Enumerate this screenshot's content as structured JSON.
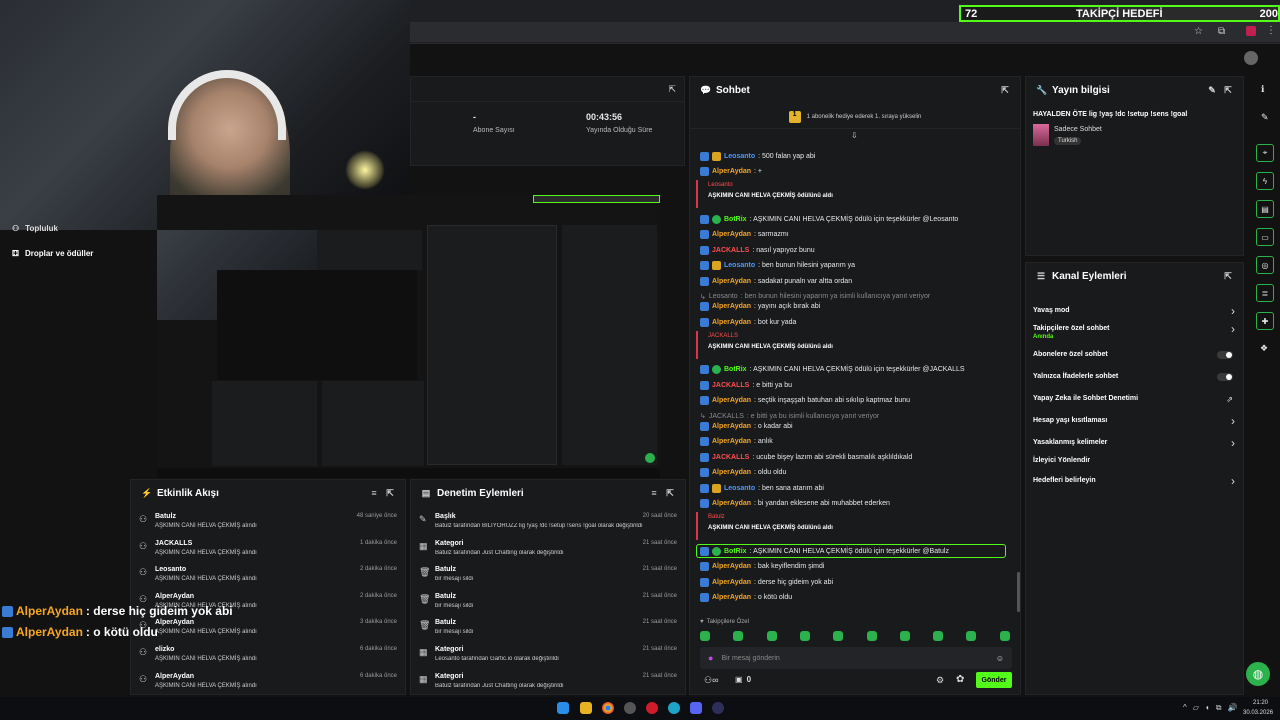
{
  "goal_bar": {
    "current": "72",
    "label": "TAKİPÇİ HEDEFİ",
    "target": "200"
  },
  "stats": {
    "subs_value": "-",
    "subs_label": "Abone Sayısı",
    "live_value": "00:43:56",
    "live_label": "Yayında Olduğu Süre"
  },
  "left_menu": {
    "drops": "Droplar ve ödüller",
    "top": "Topluluk"
  },
  "overlay_chat": [
    {
      "user": "AlperAydan",
      "msg": ": derse hiç gideim yok abi"
    },
    {
      "user": "AlperAydan",
      "msg": ": o kötü oldu"
    }
  ],
  "activity": {
    "title": "Etkinlik Akışı",
    "items": [
      {
        "name": "Batulz",
        "desc": "AŞKIMIN CANI HELVA ÇEKMİŞ alındı",
        "time": "48 saniye önce"
      },
      {
        "name": "JACKALLS",
        "desc": "AŞKIMIN CANI HELVA ÇEKMİŞ alındı",
        "time": "1 dakika önce"
      },
      {
        "name": "Leosanto",
        "desc": "AŞKIMIN CANI HELVA ÇEKMİŞ alındı",
        "time": "2 dakika önce"
      },
      {
        "name": "AlperAydan",
        "desc": "AŞKIMIN CANI HELVA ÇEKMİŞ alındı",
        "time": "2 dakika önce"
      },
      {
        "name": "AlperAydan",
        "desc": "AŞKIMIN CANI HELVA ÇEKMİŞ alındı",
        "time": "3 dakika önce"
      },
      {
        "name": "elizko",
        "desc": "AŞKIMIN CANI HELVA ÇEKMİŞ alındı",
        "time": "6 dakika önce"
      },
      {
        "name": "AlperAydan",
        "desc": "AŞKIMIN CANI HELVA ÇEKMİŞ alındı",
        "time": "6 dakika önce"
      }
    ]
  },
  "moderation": {
    "title": "Denetim Eylemleri",
    "items": [
      {
        "name": "Başlık",
        "desc": "Batulz tarafından BİLİYORUZZ lig !yaş !dc !setup !sens !goal olarak değiştirildi",
        "time": "20 saat önce",
        "icon": "✎"
      },
      {
        "name": "Kategori",
        "desc": "Batulz tarafından Just Chatting olarak değiştirildi",
        "time": "21 saat önce",
        "icon": "▦"
      },
      {
        "name": "Batulz",
        "desc": "bir mesajı sildi",
        "time": "21 saat önce",
        "icon": "🗑"
      },
      {
        "name": "Batulz",
        "desc": "bir mesajı sildi",
        "time": "21 saat önce",
        "icon": "🗑"
      },
      {
        "name": "Batulz",
        "desc": "bir mesajı sildi",
        "time": "21 saat önce",
        "icon": "🗑"
      },
      {
        "name": "Kategori",
        "desc": "Leosanto tarafından Gartic.io olarak değiştirildi",
        "time": "21 saat önce",
        "icon": "▦"
      },
      {
        "name": "Kategori",
        "desc": "Batulz tarafından Just Chatting olarak değiştirildi",
        "time": "21 saat önce",
        "icon": "▦"
      }
    ]
  },
  "chat": {
    "title": "Sohbet",
    "banner": "1 abonelik hediye ederek 1. sıraya yükselin",
    "lines": [
      {
        "user": "Leosanto",
        "color": "blue",
        "msg": ": 500 falan yap abi"
      },
      {
        "user": "AlperAydan",
        "color": "orange",
        "msg": ": +"
      },
      {
        "user": "Leosanto",
        "color": "red",
        "msg": "AŞKIMIN CANI HELVA ÇEKMİŞ ödülünü aldı",
        "redeem": true
      },
      {
        "user": "BotRix",
        "color": "green",
        "msg": ": AŞKIMIN CANI HELVA ÇEKMİŞ ödülü için teşekkürler @Leosanto"
      },
      {
        "user": "AlperAydan",
        "color": "orange",
        "msg": ": sarmazmı"
      },
      {
        "user": "JACKALLS",
        "color": "red",
        "msg": ": nasıl yapıyoz bunu"
      },
      {
        "user": "Leosanto",
        "color": "blue",
        "msg": ": ben bunun hilesini yaparım ya"
      },
      {
        "user": "AlperAydan",
        "color": "orange",
        "msg": ": sadakat punaln var altta ordan"
      },
      {
        "user": "Leosanto",
        "color": "muted",
        "msg": ": ben bunun hilesini yaparım ya isimli kullanıcıya yanıt veriyor",
        "reply": true
      },
      {
        "user": "AlperAydan",
        "color": "orange",
        "msg": ": yayını açık bırak abi"
      },
      {
        "user": "AlperAydan",
        "color": "orange",
        "msg": ": bot kur yada"
      },
      {
        "user": "JACKALLS",
        "color": "red",
        "msg": "AŞKIMIN CANI HELVA ÇEKMİŞ ödülünü aldı",
        "redeem": true
      },
      {
        "user": "BotRix",
        "color": "green",
        "msg": ": AŞKIMIN CANI HELVA ÇEKMİŞ ödülü için teşekkürler @JACKALLS"
      },
      {
        "user": "JACKALLS",
        "color": "red",
        "msg": ": e bitti ya bu"
      },
      {
        "user": "AlperAydan",
        "color": "orange",
        "msg": ": seçtik inşaşşah batuhan abi sıkılıp kaptmaz bunu"
      },
      {
        "user": "JACKALLS",
        "color": "muted",
        "msg": ": e bitti ya bu isimli kullanıcıya yanıt veriyor",
        "reply": true
      },
      {
        "user": "AlperAydan",
        "color": "orange",
        "msg": ": o kadar abi"
      },
      {
        "user": "AlperAydan",
        "color": "orange",
        "msg": ": anlık"
      },
      {
        "user": "JACKALLS",
        "color": "red",
        "msg": ": ucube bişey lazım abi sürekli basmalık aşklıldıkald"
      },
      {
        "user": "AlperAydan",
        "color": "orange",
        "msg": ": oldu oldu"
      },
      {
        "user": "Leosanto",
        "color": "blue",
        "msg": ": ben sana atarım abi"
      },
      {
        "user": "AlperAydan",
        "color": "orange",
        "msg": ": bi yandan eklesene abi muhabbet ederken"
      },
      {
        "user": "Batulz",
        "color": "red",
        "msg": "AŞKIMIN CANI HELVA ÇEKMİŞ ödülünü aldı",
        "redeem": true
      },
      {
        "user": "BotRix",
        "color": "green",
        "msg": ": AŞKIMIN CANI HELVA ÇEKMİŞ ödülü için teşekkürler @Batulz",
        "highlight": true
      },
      {
        "user": "AlperAydan",
        "color": "orange",
        "msg": ": bak keyiflendim şimdi"
      },
      {
        "user": "AlperAydan",
        "color": "orange",
        "msg": ": derse hiç gideim yok abi"
      },
      {
        "user": "AlperAydan",
        "color": "orange",
        "msg": ": o kötü oldu"
      }
    ],
    "followers_only": "Takipçilere Özel",
    "input_placeholder": "Bir mesaj gönderin",
    "count": "0",
    "send": "Gönder"
  },
  "stream_info": {
    "title": "Yayın bilgisi",
    "stream_title": "HAYALDEN ÖTE lig !yaş !dc !setup !sens !goal",
    "category": "Sadece Sohbet",
    "tag": "Turkish"
  },
  "channel_actions": {
    "title": "Kanal Eylemleri",
    "items": [
      {
        "label": "Yavaş mod",
        "sub": "",
        "kind": "arrow"
      },
      {
        "label": "Takipçilere özel sohbet",
        "sub": "Anında",
        "kind": "arrow"
      },
      {
        "label": "Abonelere özel sohbet",
        "sub": "",
        "kind": "toggle"
      },
      {
        "label": "Yalnızca İfadelerle sohbet",
        "sub": "",
        "kind": "toggle"
      },
      {
        "label": "Yapay Zeka ile Sohbet Denetimi",
        "sub": "",
        "kind": "ext"
      },
      {
        "label": "Hesap yaşı kısıtlaması",
        "sub": "",
        "kind": "arrow"
      },
      {
        "label": "Yasaklanmış kelimeler",
        "sub": "",
        "kind": "arrow"
      },
      {
        "label": "İzleyici Yönlendir",
        "sub": "",
        "kind": "none"
      },
      {
        "label": "Hedefleri belirleyin",
        "sub": "",
        "kind": "arrow"
      }
    ]
  },
  "taskbar": {
    "time": "21:20",
    "date": "30.03.2026"
  }
}
